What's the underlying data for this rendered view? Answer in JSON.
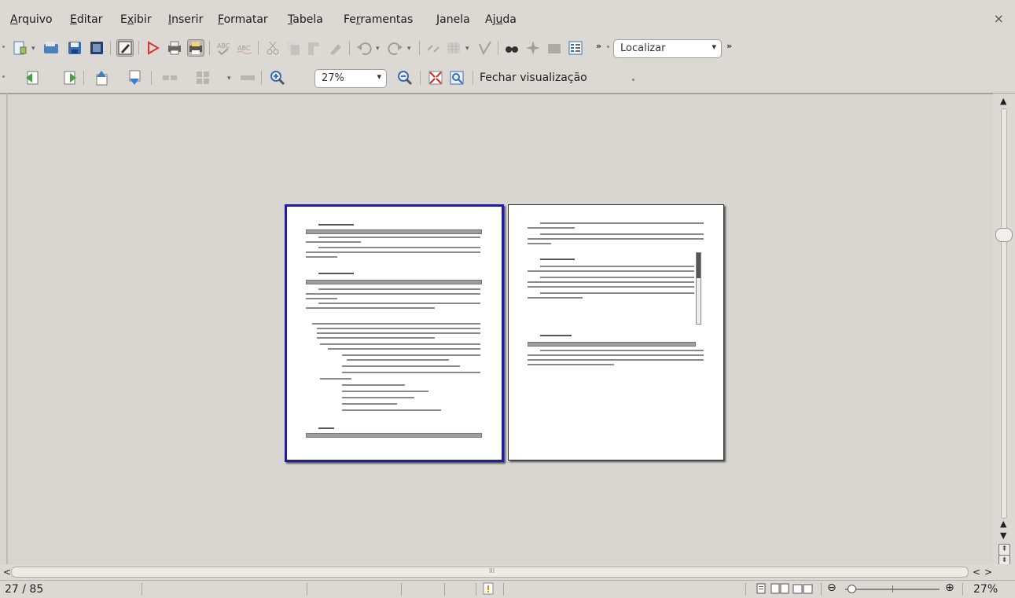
{
  "menu": [
    {
      "label": "Arquivo",
      "x": 0
    },
    {
      "label": "Editar",
      "x": 0
    },
    {
      "label": "Exibir",
      "x": 0
    },
    {
      "label": "Inserir",
      "x": 0
    },
    {
      "label": "Formatar",
      "x": 0
    },
    {
      "label": "Tabela",
      "x": 0
    },
    {
      "label": "Ferramentas",
      "x": 0
    },
    {
      "label": "Janela",
      "x": 0
    },
    {
      "label": "Ajuda",
      "x": 0
    }
  ],
  "window": {
    "close_symbol": "×"
  },
  "toolbar_standard": {
    "icons": [
      "new-document-icon",
      "open-icon",
      "save-icon",
      "save-as-icon",
      "edit-mode-icon",
      "export-pdf-icon",
      "print-icon",
      "print-preview-icon",
      "spellcheck-icon",
      "autospell-icon",
      "cut-icon",
      "copy-icon",
      "paste-icon",
      "clone-format-icon",
      "undo-icon",
      "redo-icon",
      "hyperlink-icon",
      "table-icon",
      "show-draw-icon",
      "find-replace-icon",
      "navigator-icon",
      "gallery-icon",
      "data-sources-icon"
    ],
    "overflow_symbol": "»",
    "find": {
      "value": "Localizar",
      "arrow": "▾"
    }
  },
  "toolbar_preview": {
    "zoom": {
      "value": "27%",
      "arrow": "▾"
    },
    "close_preview_label": "Fechar visualização"
  },
  "colors": {
    "page_selected_border": "#1e1e9a",
    "ui_background": "#dcd8d4"
  },
  "status": {
    "page": "27 / 85",
    "zoom_percent": "27%",
    "zoom_slider_fraction": 0.04,
    "zoom_minus": "⊖",
    "zoom_plus": "⊕",
    "hscroll_center_mark": "III"
  },
  "scrollbar": {
    "up": "▲",
    "down": "▼",
    "left": "<",
    "right": ">",
    "page_up": "⇞",
    "page_down": "⇟"
  }
}
